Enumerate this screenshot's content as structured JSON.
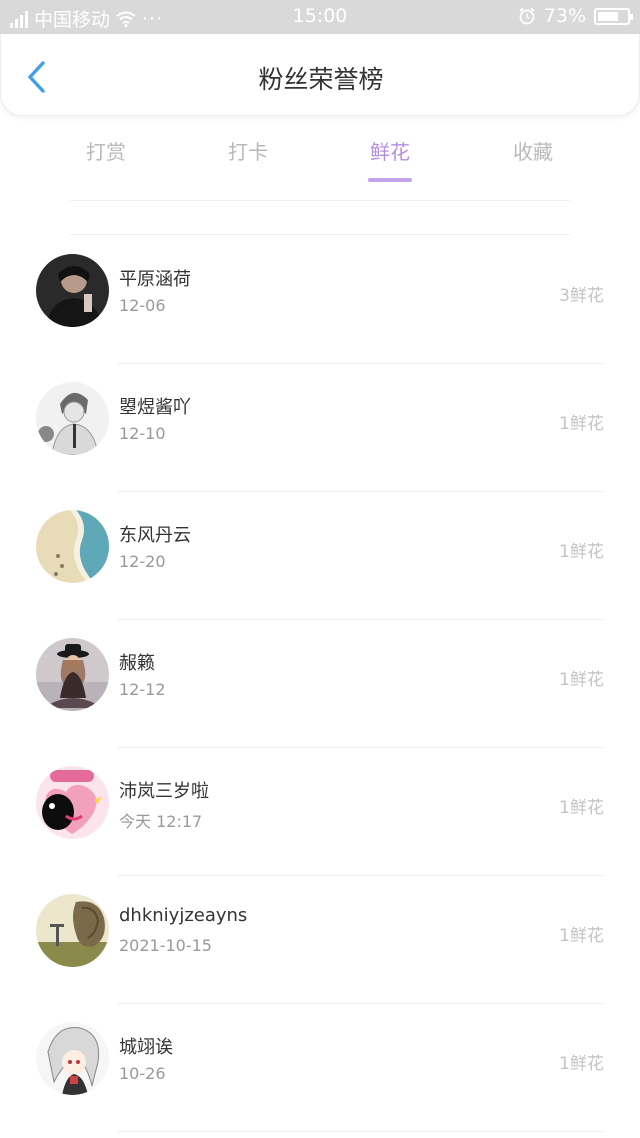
{
  "status_bar": {
    "carrier": "中国移动",
    "more": "···",
    "time": "15:00",
    "battery_text": "73%",
    "battery_level": 0.73
  },
  "nav": {
    "title": "粉丝荣誉榜"
  },
  "tabs": [
    {
      "label": "打赏",
      "active": false
    },
    {
      "label": "打卡",
      "active": false
    },
    {
      "label": "鲜花",
      "active": true
    },
    {
      "label": "收藏",
      "active": false
    }
  ],
  "fans": [
    {
      "name": "平原涵荷",
      "date": "12-06",
      "amount": "3鲜花",
      "avatar": "dark-portrait"
    },
    {
      "name": "曌煜酱吖",
      "date": "12-10",
      "amount": "1鲜花",
      "avatar": "anime-sketch"
    },
    {
      "name": "东风丹云",
      "date": "12-20",
      "amount": "1鲜花",
      "avatar": "beach"
    },
    {
      "name": "赧籁",
      "date": "12-12",
      "amount": "1鲜花",
      "avatar": "girl-hat"
    },
    {
      "name": "沛岚三岁啦",
      "date": "今天 12:17",
      "amount": "1鲜花",
      "avatar": "pink-heart"
    },
    {
      "name": "dhkniyjzeayns",
      "date": "2021-10-15",
      "amount": "1鲜花",
      "avatar": "tree-landscape"
    },
    {
      "name": "城翊诶",
      "date": "10-26",
      "amount": "1鲜花",
      "avatar": "anime-girl"
    }
  ],
  "colors": {
    "accent": "#b48fe0",
    "status_bar": "#d9d9d9",
    "back_arrow": "#3fa0ea"
  }
}
